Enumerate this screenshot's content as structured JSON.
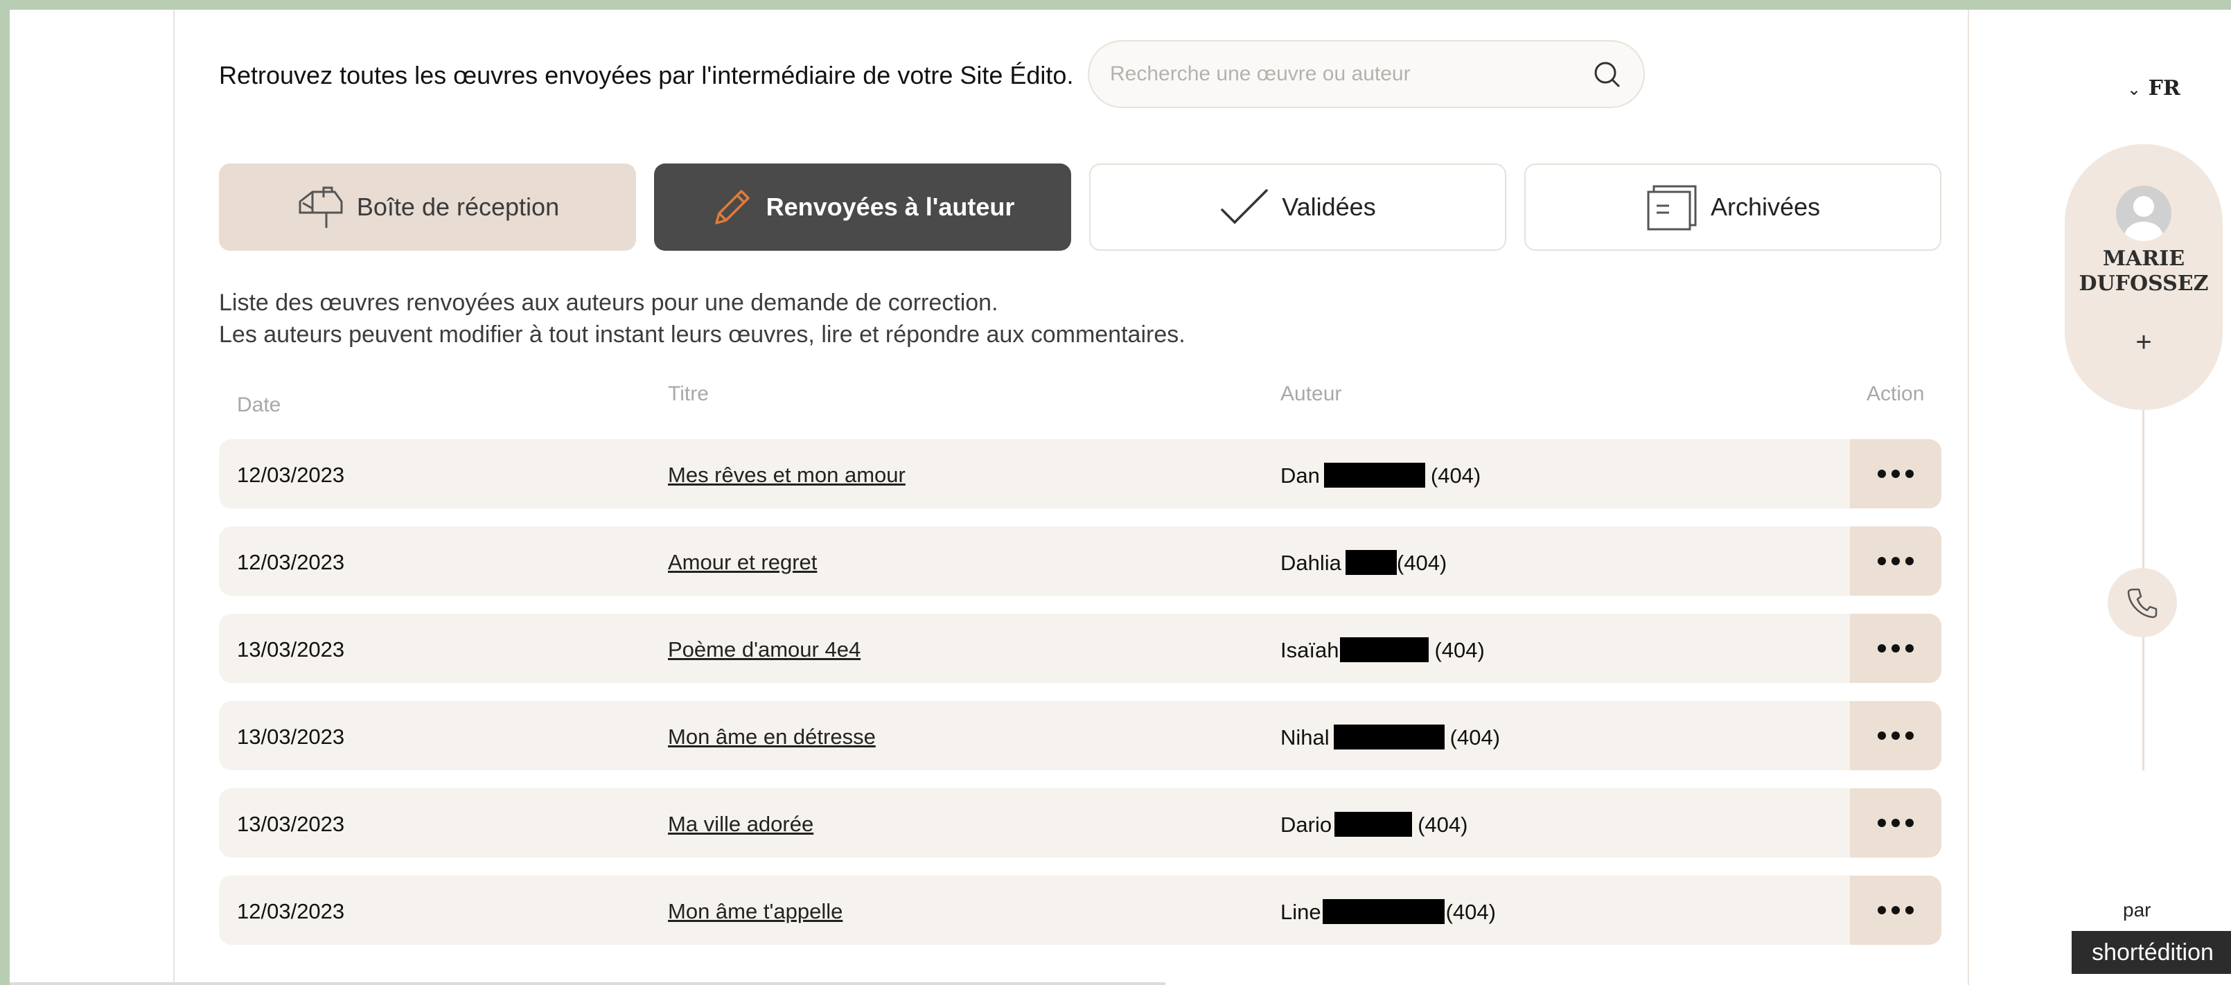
{
  "intro_text": "Retrouvez toutes les œuvres envoyées par l'intermédiaire de votre Site Édito.",
  "search": {
    "placeholder": "Recherche une œuvre ou auteur",
    "icon": "search-icon"
  },
  "tabs": [
    {
      "label": "Boîte de réception",
      "icon": "mailbox-icon",
      "active": false
    },
    {
      "label": "Renvoyées à l'auteur",
      "icon": "pencil-icon",
      "active": true
    },
    {
      "label": "Validées",
      "icon": "checkmark-icon",
      "active": false
    },
    {
      "label": "Archivées",
      "icon": "archive-folder-icon",
      "active": false
    }
  ],
  "description": [
    "Liste des œuvres renvoyées aux auteurs pour une demande de correction.",
    "Les auteurs peuvent modifier à tout instant leurs œuvres, lire et répondre aux commentaires."
  ],
  "table": {
    "headers": {
      "date": "Date",
      "title": "Titre",
      "author": "Auteur",
      "action": "Action"
    },
    "rows": [
      {
        "date": "12/03/2023",
        "title": "Mes rêves et mon amour",
        "author": "Dan",
        "suffix": "(404)"
      },
      {
        "date": "12/03/2023",
        "title": "Amour et regret",
        "author": "Dahlia",
        "suffix": "(404)"
      },
      {
        "date": "13/03/2023",
        "title": "Poème d'amour 4e4",
        "author": "Isaïah",
        "suffix": "(404)"
      },
      {
        "date": "13/03/2023",
        "title": "Mon âme en détresse",
        "author": "Nihal",
        "suffix": "(404)"
      },
      {
        "date": "13/03/2023",
        "title": "Ma ville adorée",
        "author": "Dario",
        "suffix": "(404)"
      },
      {
        "date": "12/03/2023",
        "title": "Mon âme t'appelle",
        "author": "Line",
        "suffix": "(404)"
      }
    ]
  },
  "sidebar": {
    "language": "FR",
    "user_first": "MARIE",
    "user_last": "DUFOSSEZ",
    "add_label": "+",
    "by_label": "par",
    "logo_text": "shortédition"
  },
  "colors": {
    "accent": "#e07a3a",
    "active_tab": "#4a4a4a",
    "inbox_tab": "#e8dcd3",
    "row_bg": "#f6f2ed"
  }
}
